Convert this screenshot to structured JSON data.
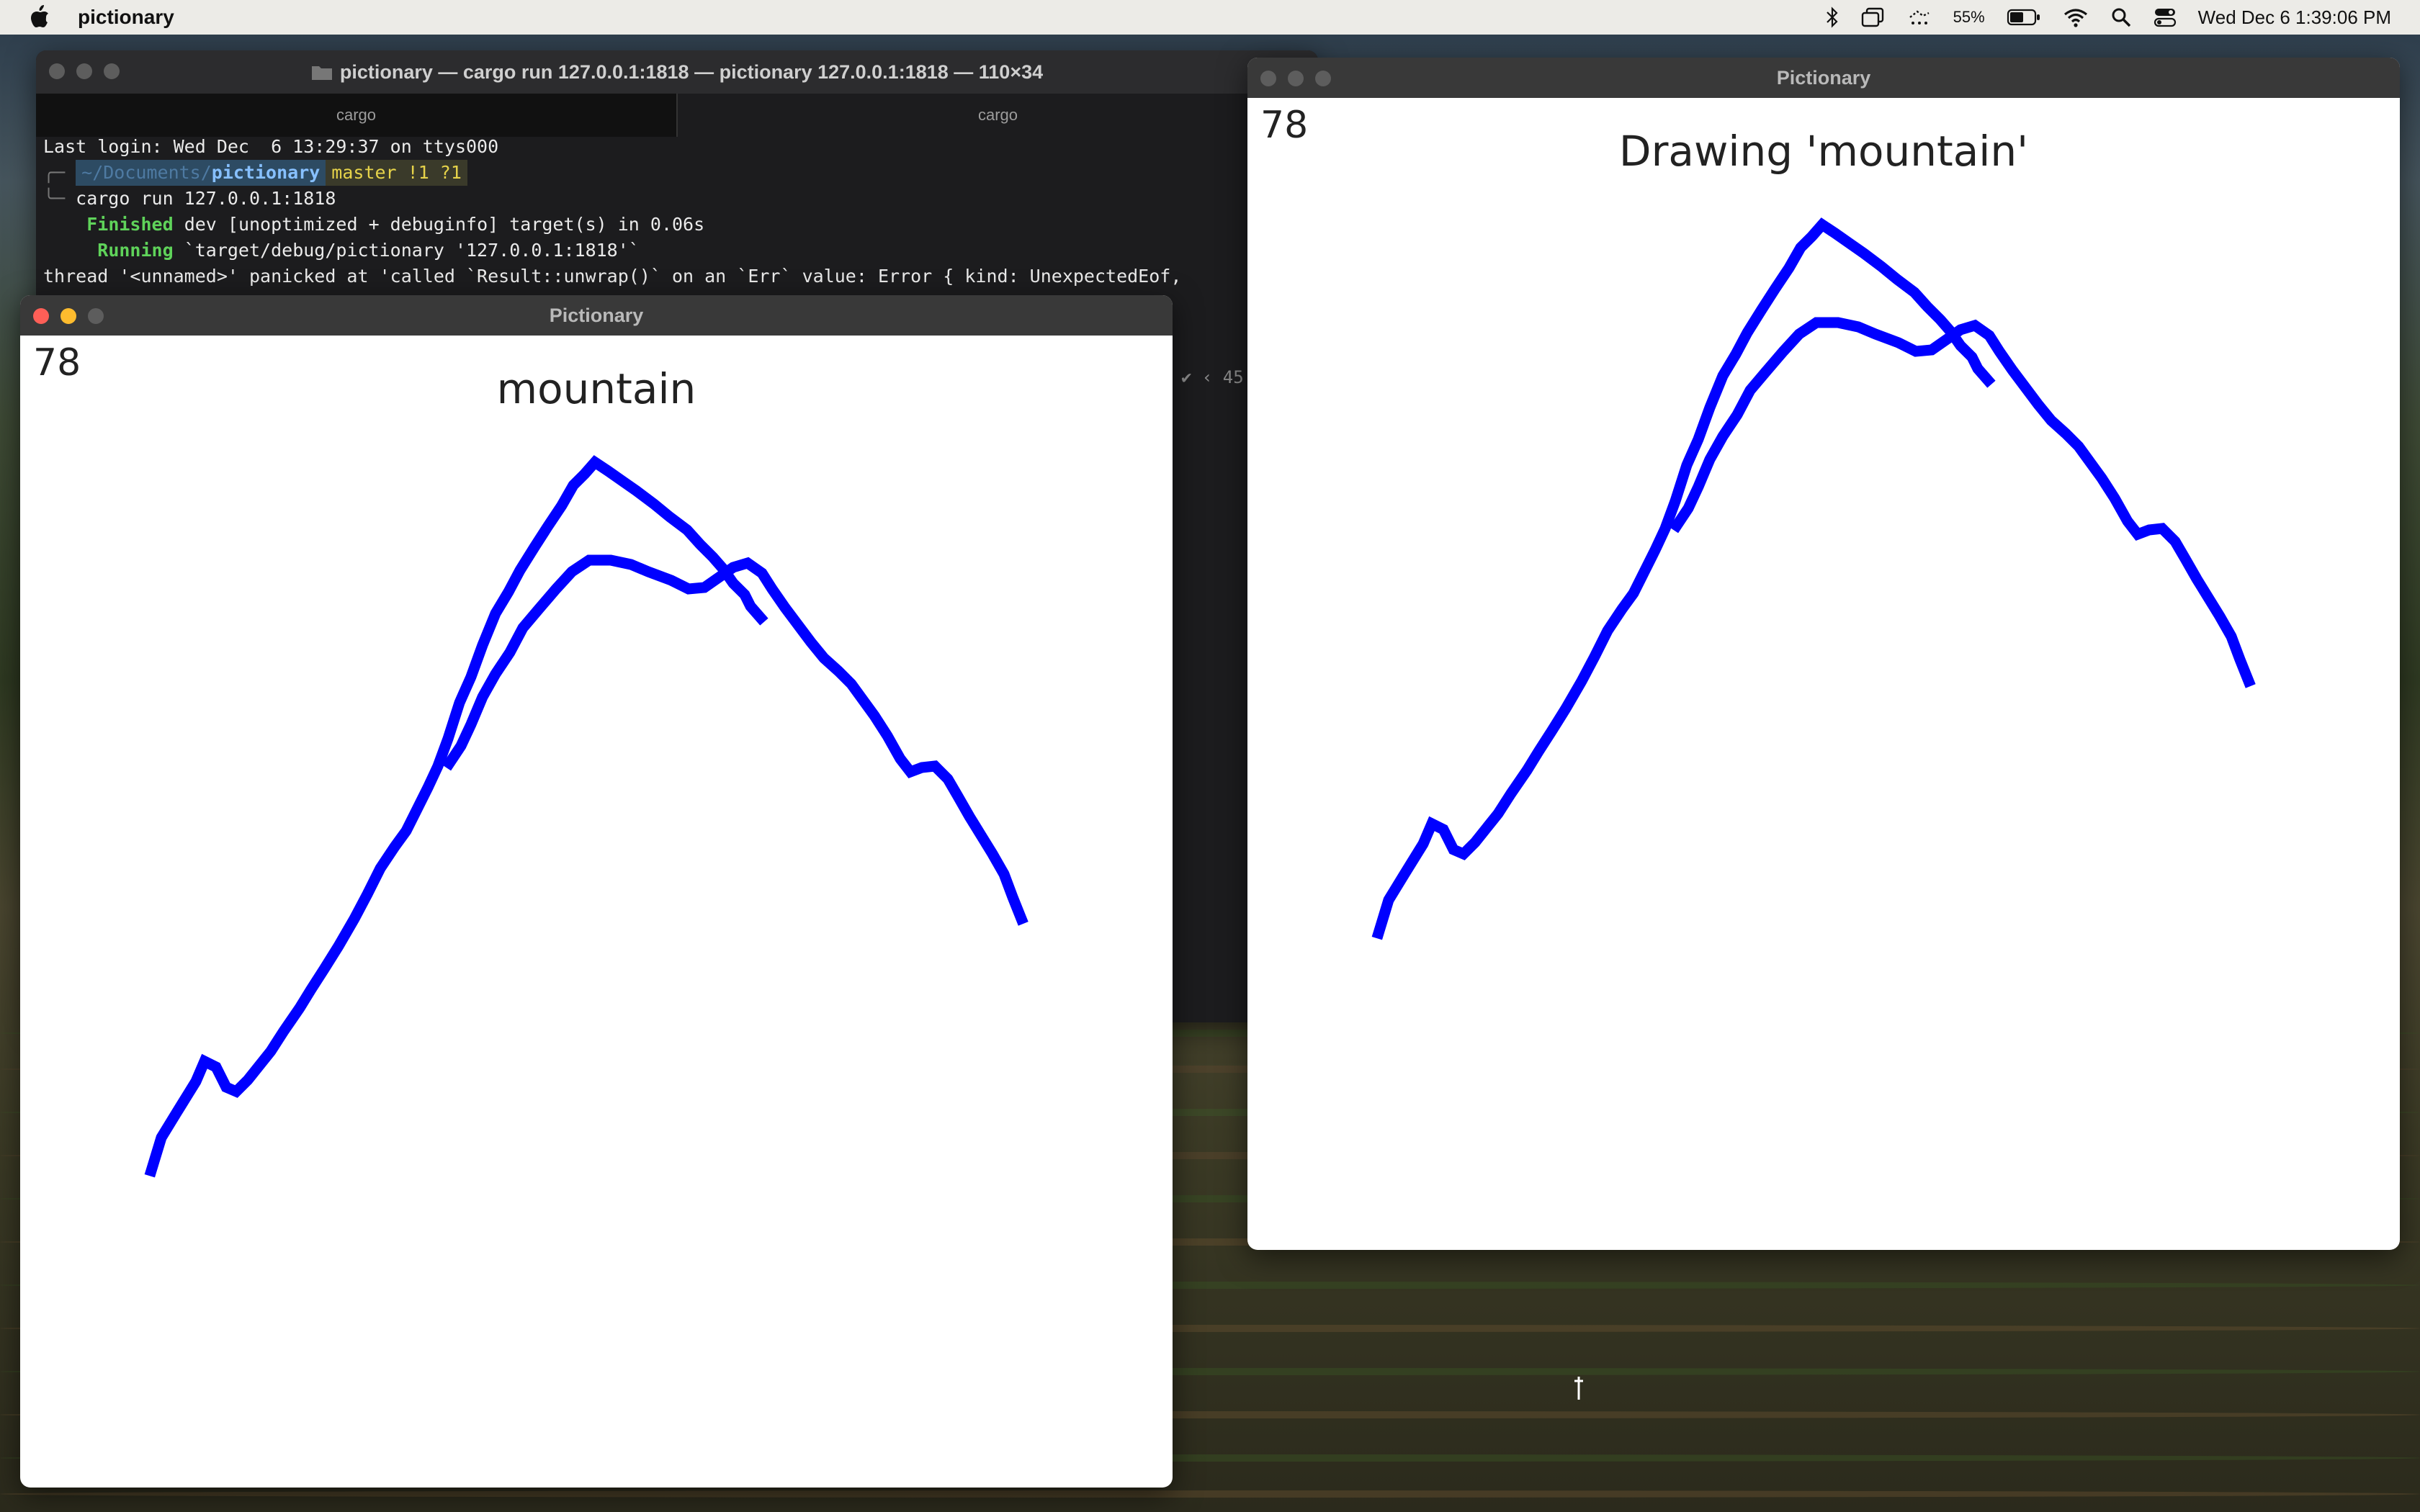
{
  "menubar": {
    "app_name": "pictionary",
    "battery_percent": "55%",
    "datetime": "Wed Dec 6  1:39:06 PM",
    "icons": [
      "apple-icon",
      "bluetooth-icon",
      "window-icon",
      "stage-manager-icon",
      "battery-icon",
      "wifi-icon",
      "search-icon",
      "control-center-icon"
    ]
  },
  "terminal": {
    "title": "pictionary — cargo run 127.0.0.1:1818 — pictionary 127.0.0.1:1818 — 110×34",
    "tabs": [
      "cargo",
      "cargo"
    ],
    "lines": {
      "login": "Last login: Wed Dec  6 13:29:37 on ttys000",
      "prompt_dir_prefix": "~/Documents/",
      "prompt_dir": "pictionary",
      "prompt_git": "master !1 ?1",
      "command": "cargo run 127.0.0.1:1818",
      "finished_label": "Finished",
      "finished_rest": " dev [unoptimized + debuginfo] target(s) in 0.06s",
      "running_label": "Running",
      "running_rest": " `target/debug/pictionary '127.0.0.1:1818'`",
      "panic": "thread '<unnamed>' panicked at 'called `Result::unwrap()` on an `Err` value: Error { kind: UnexpectedEof,"
    },
    "side_fragment": "✔ ‹ 45"
  },
  "left_window": {
    "title": "Pictionary",
    "score": "78",
    "caption": "mountain"
  },
  "right_window": {
    "title": "Pictionary",
    "score": "78",
    "caption": "Drawing 'mountain'"
  },
  "stroke_color": "#0000ff"
}
